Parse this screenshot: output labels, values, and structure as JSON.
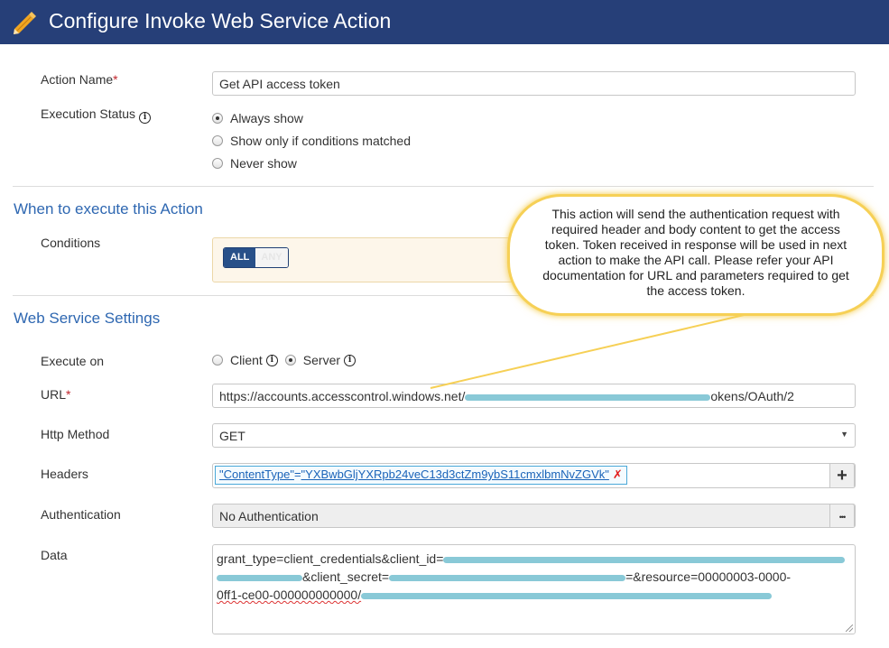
{
  "window": {
    "title": "Configure Invoke Web Service Action"
  },
  "general": {
    "action_name_label": "Action Name",
    "required_mark": "*",
    "action_name_value": "Get API access token",
    "execution_status_label": "Execution Status",
    "execution_options": [
      {
        "label": "Always show",
        "checked": true
      },
      {
        "label": "Show only if conditions matched",
        "checked": false
      },
      {
        "label": "Never show",
        "checked": false
      }
    ]
  },
  "when_section": {
    "title": "When to execute this Action",
    "conditions_label": "Conditions",
    "toggle_all": "ALL",
    "toggle_any": "ANY"
  },
  "ws_section": {
    "title": "Web Service Settings",
    "execute_on_label": "Execute on",
    "execute_on_client": "Client",
    "execute_on_server": "Server",
    "url_label": "URL",
    "url_prefix": "https://accounts.accesscontrol.windows.net/",
    "url_suffix": "okens/OAuth/2",
    "http_method_label": "Http Method",
    "http_method_value": "GET",
    "headers_label": "Headers",
    "header_key": "\"ContentType\"",
    "header_eq": "=",
    "header_value": "\"YXBwbGljYXRpb24veC13d3ctZm9ybS11cmxlbmNvZGVk\"",
    "header_remove": "✗",
    "add_symbol": "+",
    "authentication_label": "Authentication",
    "authentication_value": "No Authentication",
    "more_symbol": "•••",
    "data_label": "Data",
    "data_line1_prefix": "grant_type=client_credentials&client_id=",
    "data_line2_mid": "&client_secret=",
    "data_line2_end": "=&resource=00000003-0000-",
    "data_line3_prefix": "0ff1-ce00-000000000000/"
  },
  "callout": {
    "text": "This action will send the authentication request with required header and body content to get the access token. Token received in response will be used in next action to make the API call. Please refer your API documentation for URL and parameters required to get the access token."
  },
  "colors": {
    "title_bar": "#263f78",
    "section_title": "#2e67b1",
    "required": "#c0262d",
    "callout_border": "#f6d056",
    "redaction": "#7cc3d3"
  }
}
